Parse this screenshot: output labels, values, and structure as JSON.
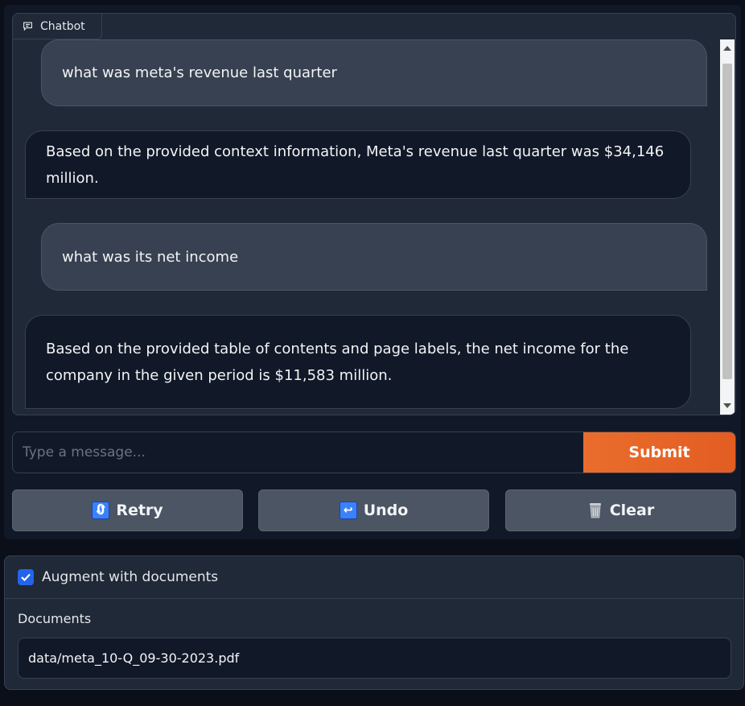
{
  "chatbot": {
    "label": "Chatbot",
    "messages": [
      {
        "role": "user",
        "text": "what was meta's revenue last quarter"
      },
      {
        "role": "bot",
        "text": "Based on the provided context information, Meta's revenue last quarter was $34,146 million."
      },
      {
        "role": "user",
        "text": "what was its net income"
      },
      {
        "role": "bot",
        "text": "Based on the provided table of contents and page labels, the net income for the company in the given period is $11,583 million."
      }
    ]
  },
  "input": {
    "placeholder": "Type a message...",
    "submit_label": "Submit"
  },
  "actions": {
    "retry_label": "Retry",
    "undo_label": "Undo",
    "clear_label": "Clear"
  },
  "settings": {
    "augment_label": "Augment with documents",
    "augment_checked": true,
    "documents_label": "Documents",
    "documents_value": "data/meta_10-Q_09-30-2023.pdf"
  },
  "colors": {
    "accent": "#ea6d2d",
    "checkbox": "#2563eb",
    "background": "#0b0f19"
  }
}
